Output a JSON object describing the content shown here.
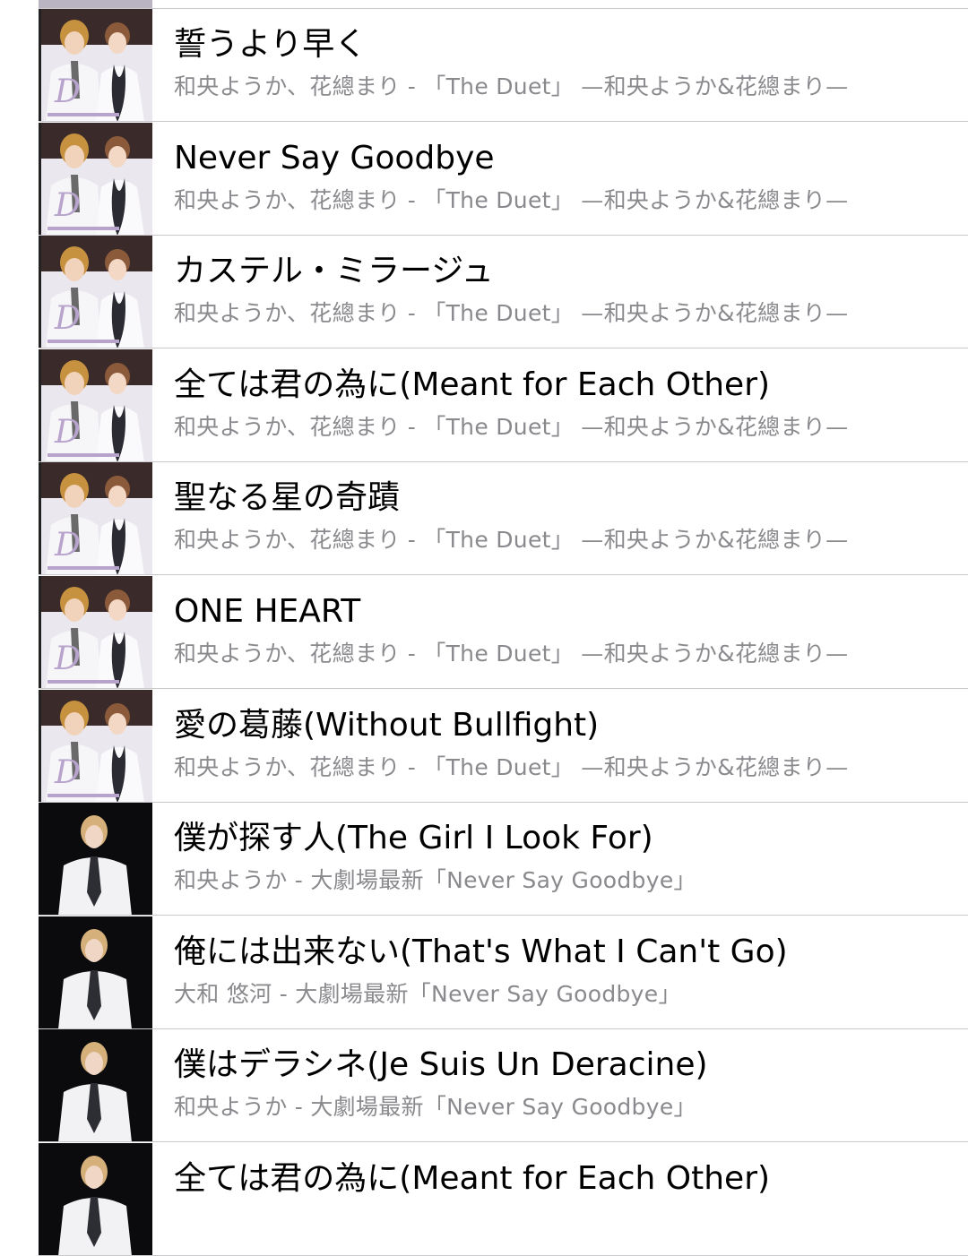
{
  "songs": [
    {
      "title": "誓うより早く",
      "subtitle": "和央ようか、花總まり - 「The Duet」 —和央ようか&花總まり—",
      "art": "duet-album-art"
    },
    {
      "title": "Never Say Goodbye",
      "subtitle": "和央ようか、花總まり - 「The Duet」 —和央ようか&花總まり—",
      "art": "duet-album-art"
    },
    {
      "title": "カステル・ミラージュ",
      "subtitle": "和央ようか、花總まり - 「The Duet」 —和央ようか&花總まり—",
      "art": "duet-album-art"
    },
    {
      "title": "全ては君の為に(Meant for Each Other)",
      "subtitle": "和央ようか、花總まり - 「The Duet」 —和央ようか&花總まり—",
      "art": "duet-album-art"
    },
    {
      "title": "聖なる星の奇蹟",
      "subtitle": "和央ようか、花總まり - 「The Duet」 —和央ようか&花總まり—",
      "art": "duet-album-art"
    },
    {
      "title": "ONE HEART",
      "subtitle": "和央ようか、花總まり - 「The Duet」 —和央ようか&花總まり—",
      "art": "duet-album-art"
    },
    {
      "title": "愛の葛藤(Without Bullfight)",
      "subtitle": "和央ようか、花總まり - 「The Duet」 —和央ようか&花總まり—",
      "art": "duet-album-art"
    },
    {
      "title": "僕が探す人(The Girl I Look For)",
      "subtitle": "和央ようか - 大劇場最新「Never Say Goodbye」",
      "art": "solo-album-art"
    },
    {
      "title": "俺には出来ない(That's What I Can't Go)",
      "subtitle": "大和 悠河 - 大劇場最新「Never Say Goodbye」",
      "art": "solo-album-art"
    },
    {
      "title": "僕はデラシネ(Je Suis Un Deracine)",
      "subtitle": "和央ようか - 大劇場最新「Never Say Goodbye」",
      "art": "solo-album-art"
    },
    {
      "title": "全ては君の為に(Meant for Each Other)",
      "subtitle": "",
      "art": "solo-album-art"
    }
  ]
}
